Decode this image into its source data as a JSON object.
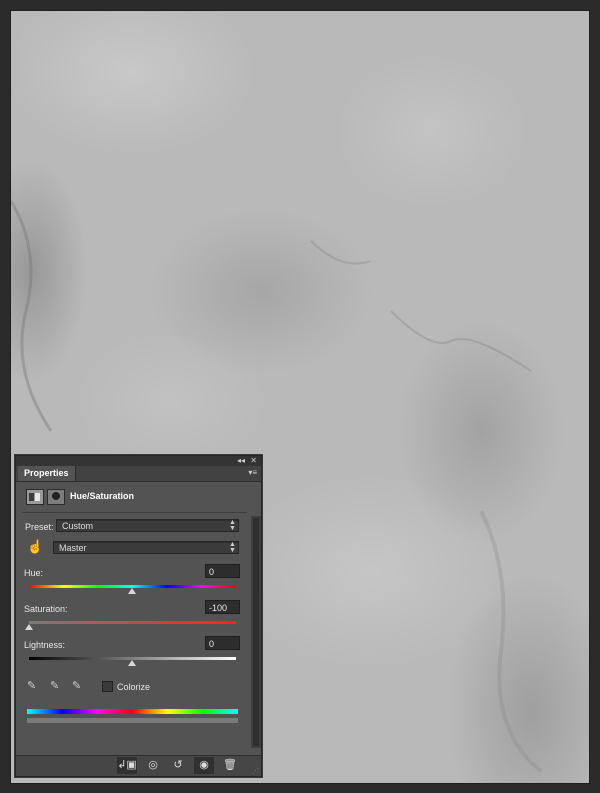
{
  "panel": {
    "tab_label": "Properties",
    "title": "Hue/Saturation",
    "preset_label": "Preset:",
    "preset_value": "Custom",
    "channel_value": "Master",
    "hue_label": "Hue:",
    "hue_value": "0",
    "saturation_label": "Saturation:",
    "saturation_value": "-100",
    "lightness_label": "Lightness:",
    "lightness_value": "0",
    "colorize_label": "Colorize",
    "colorize_checked": false,
    "hue_slider_level": 0.5,
    "saturation_slider_level": 0.0,
    "lightness_slider_level": 0.5
  },
  "icons": {
    "collapse": "double-chevron-left-icon",
    "close": "close-icon",
    "panel_menu": "panel-menu-icon",
    "adjustment": "adjustment-layer-icon",
    "mask": "layer-mask-icon",
    "target_adjust": "targeted-adjustment-hand-icon",
    "eyedropper": "eyedropper-icon",
    "eyedropper_add": "eyedropper-plus-icon",
    "eyedropper_subtract": "eyedropper-minus-icon",
    "clip": "clip-to-layer-icon",
    "view_previous": "view-previous-state-icon",
    "reset": "reset-icon",
    "visibility": "eye-icon",
    "delete": "trash-icon"
  }
}
